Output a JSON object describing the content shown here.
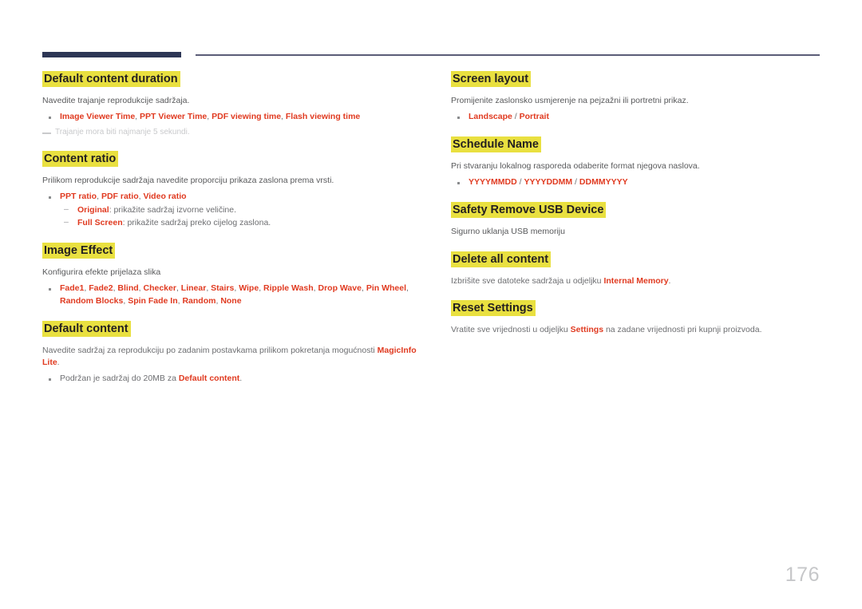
{
  "page": {
    "number": "176",
    "colors": {
      "rule_dark": "#2d3655",
      "rule_thin": "#5b5d78",
      "highlight": "#e9e040",
      "keyword": "#e03a20",
      "body": "#58595b",
      "heading": "#231f20",
      "page_number": "#c6c7c9"
    }
  },
  "left_column": {
    "sections": [
      {
        "heading": "Default content duration",
        "body": "Navedite trajanje reprodukcije sadržaja.",
        "bullets": [
          {
            "parts": [
              {
                "text": "Image Viewer Time",
                "style": "kw"
              },
              {
                "text": ", ",
                "style": "sep"
              },
              {
                "text": "PPT Viewer Time",
                "style": "kw"
              },
              {
                "text": ", ",
                "style": "sep"
              },
              {
                "text": "PDF viewing time",
                "style": "kw"
              },
              {
                "text": ", ",
                "style": "sep"
              },
              {
                "text": "Flash viewing time",
                "style": "kw"
              }
            ]
          }
        ],
        "note": "Trajanje mora biti najmanje 5 sekundi."
      },
      {
        "heading": "Content ratio",
        "body": "Prilikom reprodukcije sadržaja navedite proporciju prikaza zaslona prema vrsti.",
        "bullets": [
          {
            "parts": [
              {
                "text": "PPT ratio",
                "style": "kw"
              },
              {
                "text": ", ",
                "style": "sep"
              },
              {
                "text": "PDF ratio",
                "style": "kw"
              },
              {
                "text": ", ",
                "style": "sep"
              },
              {
                "text": "Video ratio",
                "style": "kw"
              }
            ],
            "sub": [
              {
                "parts": [
                  {
                    "text": "Original",
                    "style": "kw"
                  },
                  {
                    "text": ": prikažite sadržaj izvorne veličine.",
                    "style": "sep"
                  }
                ]
              },
              {
                "parts": [
                  {
                    "text": "Full Screen",
                    "style": "kw"
                  },
                  {
                    "text": ": prikažite sadržaj preko cijelog zaslona.",
                    "style": "sep"
                  }
                ]
              }
            ]
          }
        ]
      },
      {
        "heading": "Image Effect",
        "body": "Konfigurira efekte prijelaza slika",
        "bullets": [
          {
            "parts": [
              {
                "text": "Fade1",
                "style": "kw"
              },
              {
                "text": ", ",
                "style": "sep"
              },
              {
                "text": "Fade2",
                "style": "kw"
              },
              {
                "text": ", ",
                "style": "sep"
              },
              {
                "text": "Blind",
                "style": "kw"
              },
              {
                "text": ", ",
                "style": "sep"
              },
              {
                "text": "Checker",
                "style": "kw"
              },
              {
                "text": ", ",
                "style": "sep"
              },
              {
                "text": "Linear",
                "style": "kw"
              },
              {
                "text": ", ",
                "style": "sep"
              },
              {
                "text": "Stairs",
                "style": "kw"
              },
              {
                "text": ", ",
                "style": "sep"
              },
              {
                "text": "Wipe",
                "style": "kw"
              },
              {
                "text": ", ",
                "style": "sep"
              },
              {
                "text": "Ripple Wash",
                "style": "kw"
              },
              {
                "text": ", ",
                "style": "sep"
              },
              {
                "text": "Drop Wave",
                "style": "kw"
              },
              {
                "text": ", ",
                "style": "sep"
              },
              {
                "text": "Pin Wheel",
                "style": "kw"
              },
              {
                "text": ", ",
                "style": "sep"
              },
              {
                "text": "Random Blocks",
                "style": "kw"
              },
              {
                "text": ", ",
                "style": "sep"
              },
              {
                "text": "Spin Fade In",
                "style": "kw"
              },
              {
                "text": ", ",
                "style": "sep"
              },
              {
                "text": "Random",
                "style": "kw"
              },
              {
                "text": ", ",
                "style": "sep"
              },
              {
                "text": "None",
                "style": "kw"
              }
            ]
          }
        ]
      },
      {
        "heading": "Default content",
        "body_parts": [
          {
            "text": "Navedite sadržaj za reprodukciju po zadanim postavkama prilikom pokretanja mogućnosti ",
            "style": "sep"
          },
          {
            "text": "MagicInfo Lite",
            "style": "kw"
          },
          {
            "text": ".",
            "style": "sep"
          }
        ],
        "bullets": [
          {
            "parts": [
              {
                "text": "Podržan je sadržaj do 20MB za ",
                "style": "sep"
              },
              {
                "text": "Default content",
                "style": "kw"
              },
              {
                "text": ".",
                "style": "sep"
              }
            ]
          }
        ]
      }
    ]
  },
  "right_column": {
    "sections": [
      {
        "heading": "Screen layout",
        "body": "Promijenite zaslonsko usmjerenje na pejzažni ili portretni prikaz.",
        "bullets": [
          {
            "parts": [
              {
                "text": "Landscape",
                "style": "kw"
              },
              {
                "text": " / ",
                "style": "sep"
              },
              {
                "text": "Portrait",
                "style": "kw"
              }
            ]
          }
        ]
      },
      {
        "heading": "Schedule Name",
        "body": "Pri stvaranju lokalnog rasporeda odaberite format njegova naslova.",
        "bullets": [
          {
            "parts": [
              {
                "text": "YYYYMMDD",
                "style": "kw"
              },
              {
                "text": " / ",
                "style": "sep"
              },
              {
                "text": "YYYYDDMM",
                "style": "kw"
              },
              {
                "text": " / ",
                "style": "sep"
              },
              {
                "text": "DDMMYYYY",
                "style": "kw"
              }
            ]
          }
        ]
      },
      {
        "heading": "Safety Remove USB Device",
        "body": "Sigurno uklanja USB memoriju",
        "bullets": []
      },
      {
        "heading": "Delete all content",
        "body_parts": [
          {
            "text": "Izbrišite sve datoteke sadržaja u odjeljku ",
            "style": "sep"
          },
          {
            "text": "Internal Memory",
            "style": "kw"
          },
          {
            "text": ".",
            "style": "sep"
          }
        ],
        "bullets": []
      },
      {
        "heading": "Reset Settings",
        "body_parts": [
          {
            "text": "Vratite sve vrijednosti u odjeljku ",
            "style": "sep"
          },
          {
            "text": "Settings",
            "style": "kw"
          },
          {
            "text": " na zadane vrijednosti pri kupnji proizvoda.",
            "style": "sep"
          }
        ],
        "bullets": []
      }
    ]
  }
}
